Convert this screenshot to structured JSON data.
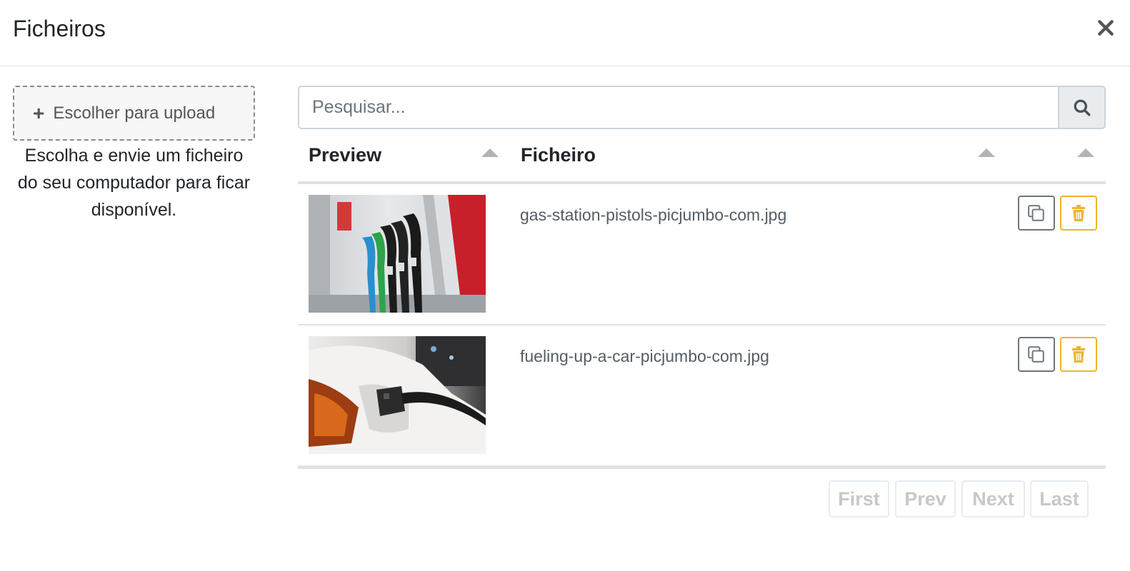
{
  "modal": {
    "title": "Ficheiros"
  },
  "upload": {
    "button_icon": "plus-icon",
    "button_label": "Escolher para upload",
    "help_text": "Escolha e envie um ficheiro do seu computador para ficar disponível."
  },
  "search": {
    "placeholder": "Pesquisar...",
    "value": "",
    "icon": "search-icon"
  },
  "table": {
    "columns": [
      {
        "label": "Preview",
        "sortable": true
      },
      {
        "label": "Ficheiro",
        "sortable": true
      },
      {
        "label": "",
        "sortable": true
      }
    ],
    "rows": [
      {
        "filename": "gas-station-pistols-picjumbo-com.jpg",
        "thumbnail": "gas-station-pumps-photo",
        "actions": [
          "copy-icon",
          "trash-icon"
        ]
      },
      {
        "filename": "fueling-up-a-car-picjumbo-com.jpg",
        "thumbnail": "car-fueling-photo",
        "actions": [
          "copy-icon",
          "trash-icon"
        ]
      }
    ]
  },
  "pagination": {
    "first": "First",
    "prev": "Prev",
    "next": "Next",
    "last": "Last"
  },
  "colors": {
    "delete_accent": "#f0b428",
    "copy_border": "#6c757d",
    "disabled_text": "#c6c8ca"
  }
}
